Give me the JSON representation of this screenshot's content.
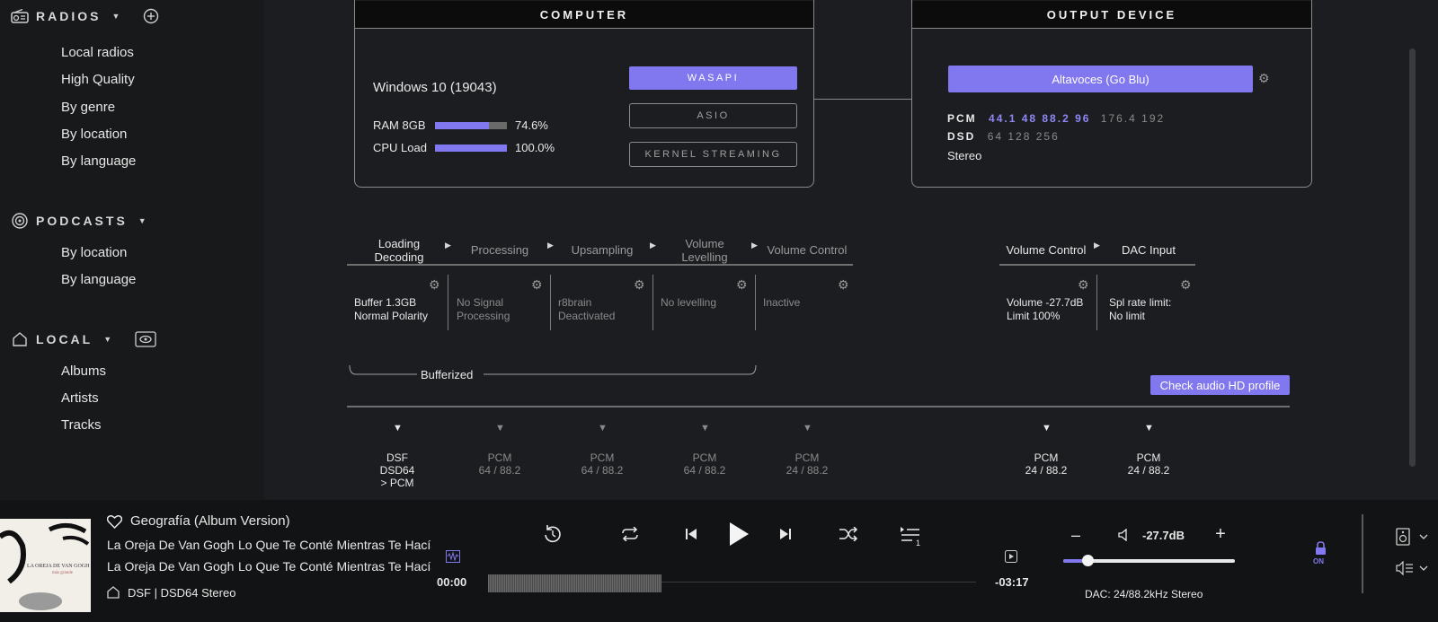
{
  "sidebar": {
    "radios": {
      "title": "RADIOS",
      "items": [
        "Local radios",
        "High Quality",
        "By genre",
        "By location",
        "By language"
      ]
    },
    "podcasts": {
      "title": "PODCASTS",
      "items": [
        "By location",
        "By language"
      ]
    },
    "local": {
      "title": "LOCAL",
      "items": [
        "Albums",
        "Artists",
        "Tracks"
      ]
    }
  },
  "computer": {
    "header": "COMPUTER",
    "os": "Windows 10 (19043)",
    "ram_label": "RAM 8GB",
    "ram_value": "74.6%",
    "ram_fill": 0.746,
    "cpu_label": "CPU Load",
    "cpu_value": "100.0%",
    "cpu_fill": 1.0,
    "modes": [
      "WASAPI",
      "ASIO",
      "KERNEL STREAMING"
    ],
    "active_mode": "WASAPI"
  },
  "output": {
    "header": "OUTPUT DEVICE",
    "device": "Altavoces (Go Blu)",
    "pcm_label": "PCM",
    "pcm_supported": "44.1 48 88.2 96",
    "pcm_unsupported": "176.4 192",
    "dsd_label": "DSD",
    "dsd_rates": "64 128 256",
    "channels": "Stereo"
  },
  "pipeline": {
    "stages": [
      {
        "label": "Loading\nDecoding",
        "status": "Buffer 1.3GB\nNormal Polarity",
        "active": true,
        "format": "DSF\nDSD64\n> PCM"
      },
      {
        "label": "Processing",
        "status": "No Signal\nProcessing",
        "active": false,
        "format": "PCM\n64 / 88.2"
      },
      {
        "label": "Upsampling",
        "status": "r8brain\nDeactivated",
        "active": false,
        "format": "PCM\n64 / 88.2"
      },
      {
        "label": "Volume\nLevelling",
        "status": "No levelling",
        "active": false,
        "format": "PCM\n64 / 88.2"
      },
      {
        "label": "Volume Control",
        "status": "Inactive",
        "active": false,
        "format": "PCM\n24 / 88.2"
      }
    ],
    "output_stages": [
      {
        "label": "Volume Control",
        "status": "Volume -27.7dB\nLimit 100%",
        "format": "PCM\n24 / 88.2"
      },
      {
        "label": "DAC Input",
        "status": "Spl rate limit:\nNo limit",
        "format": "PCM\n24 / 88.2"
      }
    ],
    "bufferized": "Bufferized",
    "hd_button": "Check audio HD profile"
  },
  "player": {
    "title": "Geografía (Album Version)",
    "artist1": "La Oreja De Van Gogh",
    "album1": "Lo Que Te Conté Mientras Te Hacías",
    "artist2": "La Oreja De Van Gogh",
    "album2": "Lo Que Te Conté Mientras Te Hacías",
    "format": "DSF | DSD64 Stereo",
    "elapsed": "00:00",
    "remaining": "-03:17",
    "volume": "-27.7dB",
    "volume_level": 0.14,
    "lock_state": "ON",
    "dac": "DAC: 24/88.2kHz Stereo",
    "queue_count": "1",
    "cover_text1": "LA OREJA DE VAN GOGH",
    "cover_text2": "más grande"
  }
}
